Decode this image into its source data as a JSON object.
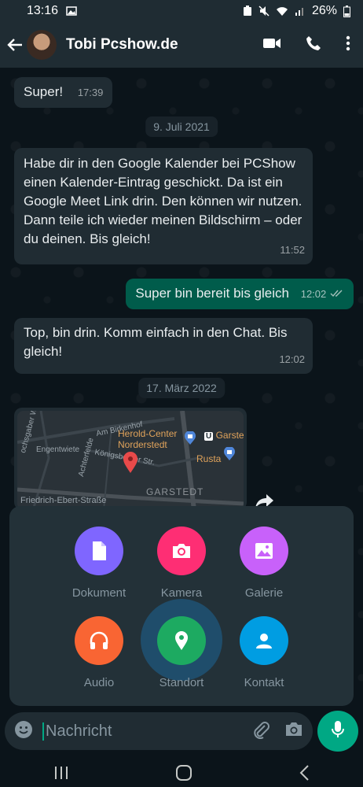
{
  "status_bar": {
    "time": "13:16",
    "battery": "26%"
  },
  "header": {
    "contact_name": "Tobi Pcshow.de"
  },
  "messages": {
    "m1": {
      "text": "Super!",
      "time": "17:39"
    },
    "date1": "9. Juli 2021",
    "m2": {
      "text": "Habe dir in den Google Kalender bei PCShow einen Kalender-Eintrag geschickt. Da ist ein Google Meet Link drin. Den können wir nutzen. Dann teile ich wieder meinen Bildschirm – oder du deinen. Bis gleich!",
      "time": "11:52"
    },
    "m3": {
      "text": "Super bin bereit bis gleich",
      "time": "12:02",
      "status_icon": "double-check-icon"
    },
    "m4": {
      "text": "Top, bin drin. Komm einfach in den Chat. Bis gleich!",
      "time": "12:02"
    },
    "date2": "17. März 2022",
    "map": {
      "labels": {
        "l1": "Am Birkenhof",
        "l2": "Engentwiete",
        "l3": "Königsberger Str.",
        "l4": "Achterfelde",
        "l5": "Friedrich-Ebert-Straße",
        "l6": "ochsgaber Weg",
        "poi1": "Herold-Center Norderstedt",
        "poi2": "Garste",
        "poi3": "Rusta",
        "district": "GARSTEDT"
      }
    }
  },
  "attach_sheet": {
    "options": [
      {
        "label": "Dokument",
        "color": "#7f66ff",
        "icon": "document-icon"
      },
      {
        "label": "Kamera",
        "color": "#fe2e74",
        "icon": "camera-icon"
      },
      {
        "label": "Galerie",
        "color": "#c861fa",
        "icon": "gallery-icon"
      },
      {
        "label": "Audio",
        "color": "#f96533",
        "icon": "headphones-icon"
      },
      {
        "label": "Standort",
        "color": "#1daa61",
        "icon": "location-pin-icon"
      },
      {
        "label": "Kontakt",
        "color": "#009de2",
        "icon": "contact-icon"
      }
    ]
  },
  "composer": {
    "placeholder": "Nachricht"
  }
}
